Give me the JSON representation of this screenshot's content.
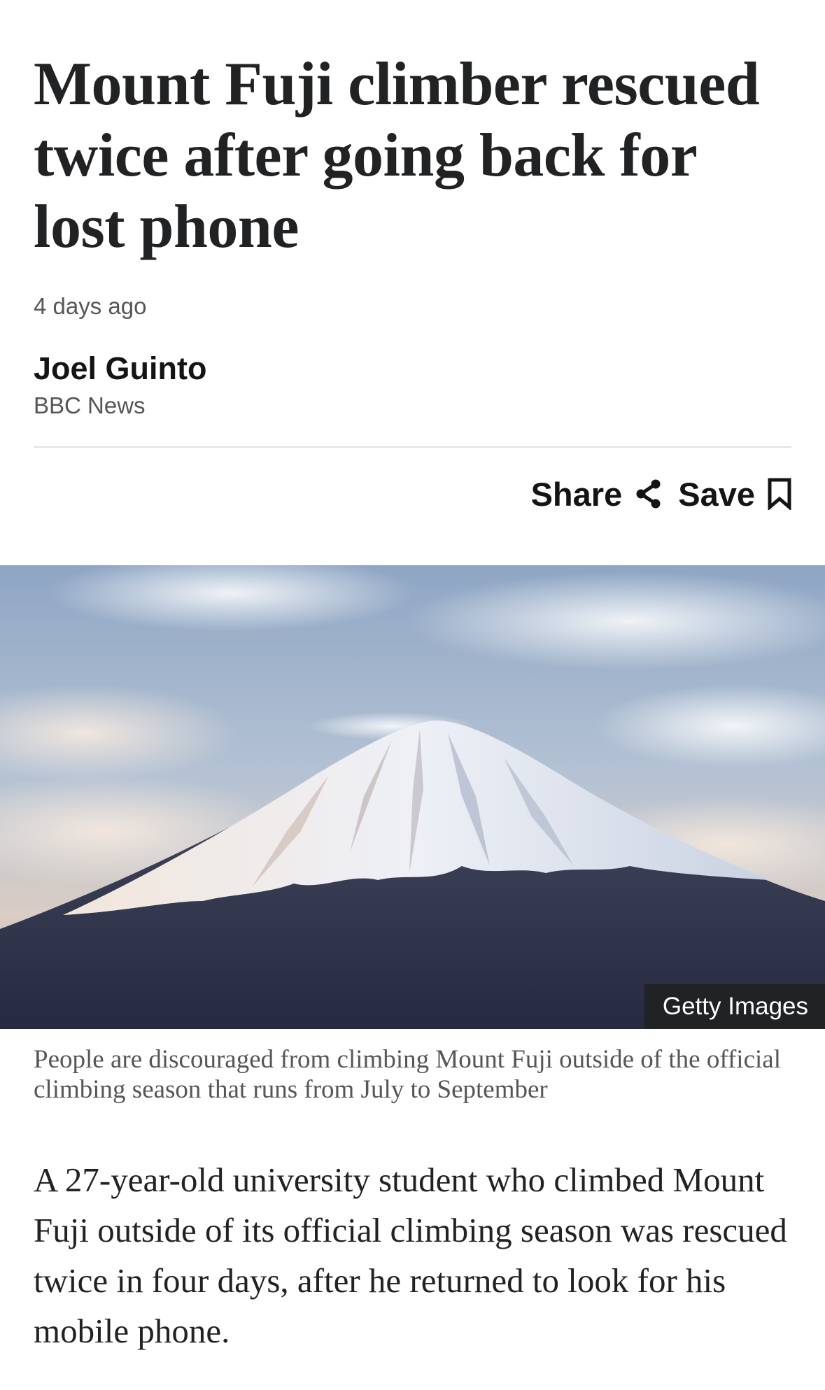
{
  "article": {
    "headline": "Mount Fuji climber rescued twice after going back for lost phone",
    "timestamp": "4 days ago",
    "author": "Joel Guinto",
    "organization": "BBC News"
  },
  "actions": {
    "share_label": "Share",
    "share_icon": "share-icon",
    "save_label": "Save",
    "save_icon": "bookmark-icon"
  },
  "image": {
    "subject": "Mount Fuji snow-capped peak under cloudy sky",
    "credit": "Getty Images",
    "caption": "People are discouraged from climbing Mount Fuji outside of the official climbing season that runs from July to September"
  },
  "body": {
    "paragraph_1": "A 27-year-old university student who climbed Mount Fuji outside of its official climbing season was rescued twice in four days, after he returned to look for his mobile phone."
  },
  "colors": {
    "text": "#202224",
    "secondary_text": "#545658",
    "divider": "#e1e1e1",
    "credit_bg": "#202224"
  }
}
